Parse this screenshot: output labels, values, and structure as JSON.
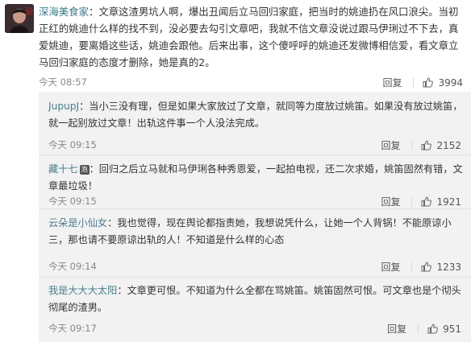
{
  "main": {
    "username": "深海美食家",
    "text": "：文章这渣男坑人啊，爆出丑闻后立马回归家庭，把当时的姚迪扔在风口浪尖。当初正红的姚迪什么样的找不到，没必要去勾引文章吧，我就不信文章没说过跟马伊琍过不下去，真爱姚迪，要离婚这些话，姚迪会跟他。后来出事，这个傻呼呼的姚迪还发微博相信爱，看文章立马回归家庭的态度才删除，她是真的2。",
    "time": "今天 08:57",
    "reply_label": "回复",
    "likes": "3994"
  },
  "replies": [
    {
      "username": "JupupJ",
      "text": "：当小三没有理，但是如果大家放过了文章，就同等力度放过姚笛。如果没有放过姚笛，就一起别放过文章！出轨这件事一个人没法完成。",
      "time": "今天 09:15",
      "reply_label": "回复",
      "likes": "2152"
    },
    {
      "username": "藏十七",
      "badge": "泡",
      "text": "：回归之后立马就和马伊琍各种秀恩爱，一起拍电视，还二次求婚，姚笛固然有错，文章最垃圾！",
      "time": "今天 09:15",
      "reply_label": "回复",
      "likes": "1921"
    },
    {
      "username": "云朵是小仙女",
      "text": "：我也觉得，现在舆论都指责她，我想说凭什么，让她一个人背锅！不能原谅小三，那也请不要原谅出轨的人！不知道是什么样的心态",
      "time": "今天 09:14",
      "reply_label": "回复",
      "likes": "1233"
    },
    {
      "username": "我是大大大太阳",
      "text": "：文章更可恨。不知道为什么全都在骂姚笛。姚笛固然可恨。可文章也是个彻头彻尾的渣男。",
      "time": "今天 09:17",
      "reply_label": "回复",
      "likes": "951"
    }
  ],
  "colors": {
    "username": "#3a7a8c",
    "username_reply": "#4a7d8f",
    "reply_bg": "#f2f2f2",
    "meta": "#888888"
  },
  "icons": {
    "avatar": "avatar-photo",
    "like": "thumbs-up-icon",
    "badge": "member-badge-icon"
  }
}
